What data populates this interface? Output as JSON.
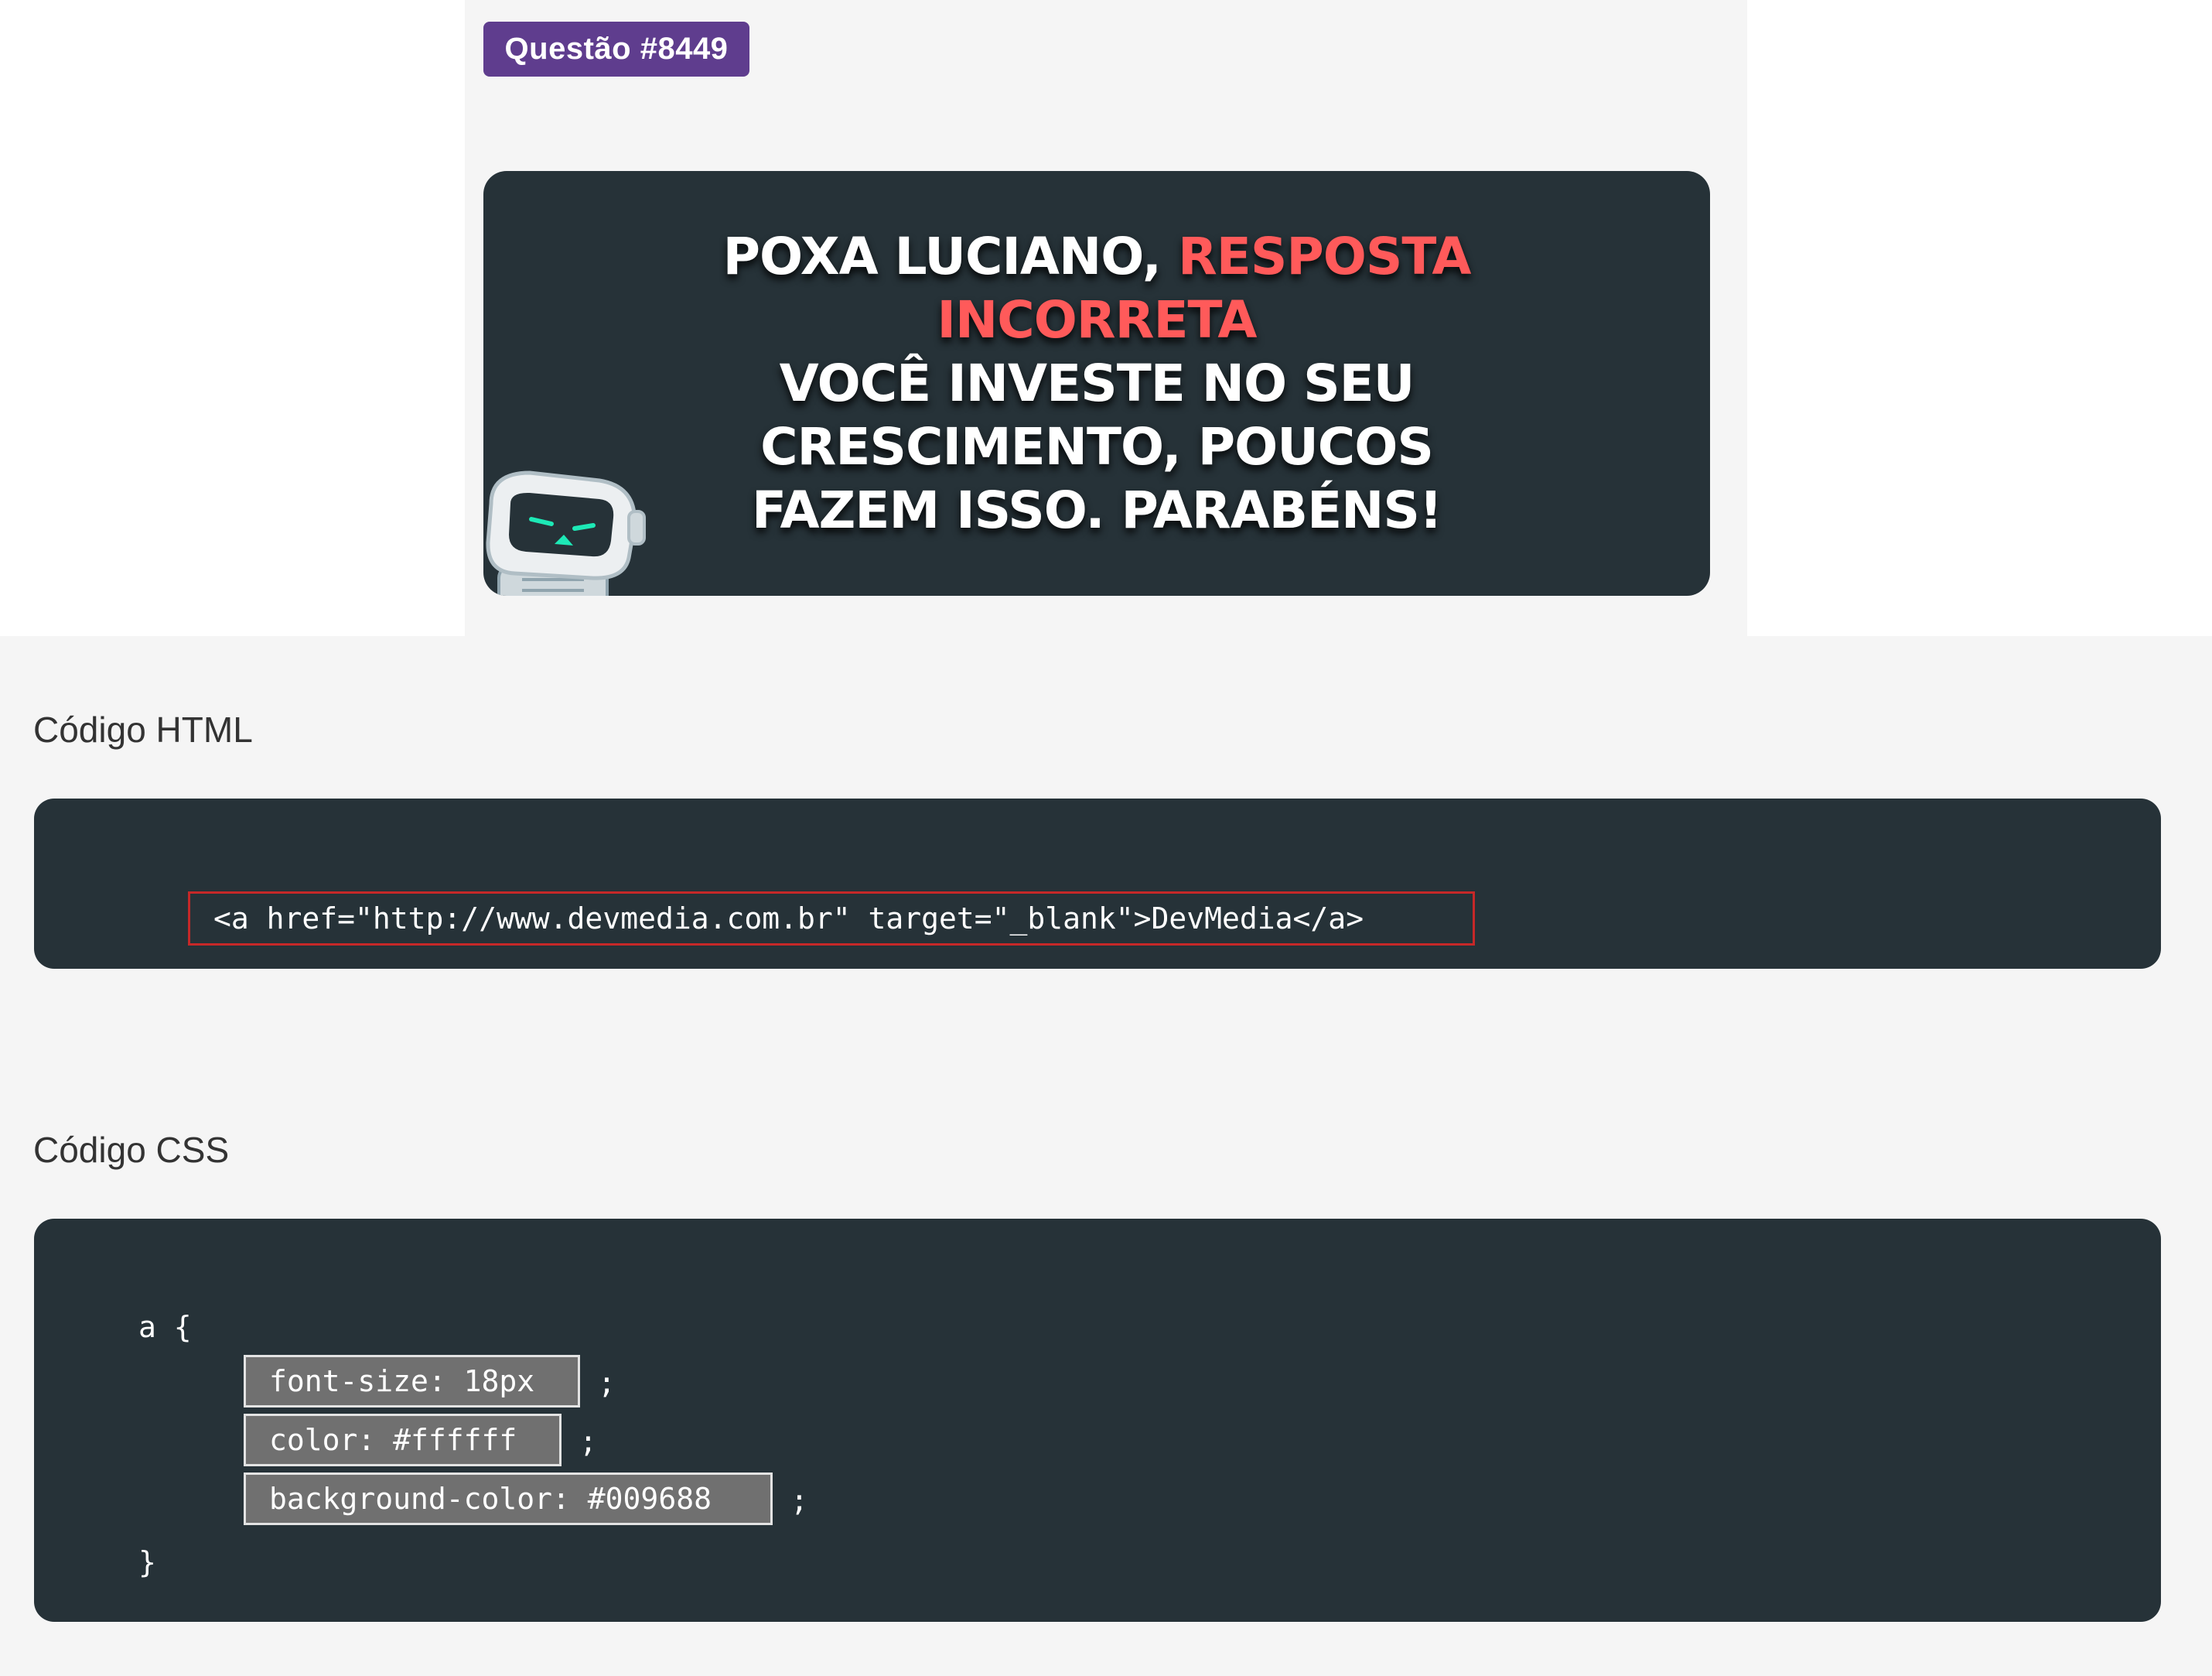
{
  "question": {
    "badge": "Questão #8449"
  },
  "feedback": {
    "line1_prefix": "POXA LUCIANO, ",
    "line1_accent": "RESPOSTA",
    "line2_accent": "INCORRETA",
    "line3": "VOCÊ INVESTE NO SEU",
    "line4": "CRESCIMENTO, POUCOS",
    "line5": "FAZEM ISSO. PARABÉNS!",
    "robot_icon": "robot-mascot-icon"
  },
  "html_section": {
    "label": "Código HTML",
    "code": "<a href=\"http://www.devmedia.com.br\" target=\"_blank\">DevMedia</a>"
  },
  "css_section": {
    "label": "Código CSS",
    "open": "a {",
    "declarations": [
      {
        "text": "font-size: 18px",
        "terminator": ";"
      },
      {
        "text": "color: #ffffff",
        "terminator": ";"
      },
      {
        "text": "background-color: #009688",
        "terminator": ";"
      }
    ],
    "close": "}"
  },
  "colors": {
    "badge": "#5f3d8e",
    "panel": "#263238",
    "accent_red": "#ff5a5a",
    "highlight_border": "#c62828",
    "answer_box": "#707070"
  }
}
